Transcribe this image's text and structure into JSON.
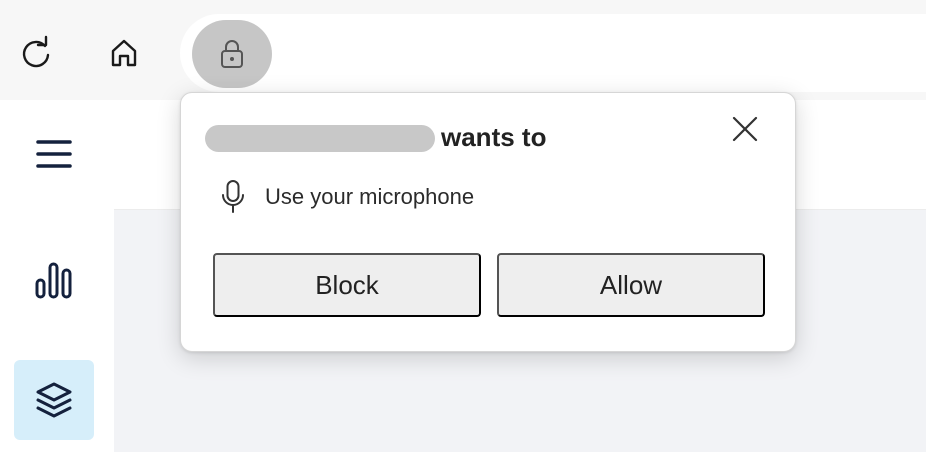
{
  "toolbar": {
    "reload_icon": "reload-icon",
    "home_icon": "home-icon",
    "site_info_icon": "lock-icon"
  },
  "sidebar": {
    "items": [
      {
        "icon": "hamburger-menu-icon"
      },
      {
        "icon": "bar-chart-icon"
      },
      {
        "icon": "layers-icon",
        "active": true
      }
    ]
  },
  "permission_prompt": {
    "title_suffix": "wants to",
    "permission": "Use your microphone",
    "permission_icon": "microphone-icon",
    "block_label": "Block",
    "allow_label": "Allow",
    "close_icon": "close-icon"
  },
  "colors": {
    "accent_active_bg": "#d6eefa",
    "icon_navy": "#14213d",
    "button_bg": "#eeeeee"
  }
}
